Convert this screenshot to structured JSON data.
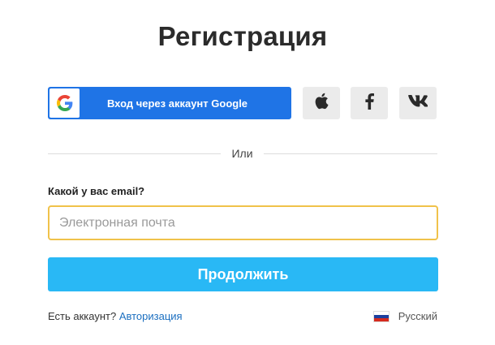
{
  "page": {
    "title": "Регистрация"
  },
  "social": {
    "google_label": "Вход через аккаунт Google",
    "icons": [
      "google-icon",
      "apple-icon",
      "facebook-icon",
      "vk-icon"
    ]
  },
  "divider": {
    "text": "Или"
  },
  "form": {
    "email_label": "Какой у вас email?",
    "email_placeholder": "Электронная почта",
    "email_value": "",
    "continue_label": "Продолжить"
  },
  "footer": {
    "account_text": "Есть аккаунт?",
    "login_link": "Авторизация",
    "language": "Русский"
  },
  "colors": {
    "google_blue": "#1f74e6",
    "primary_button": "#29b8f5",
    "input_focus_border": "#f0c24a",
    "link": "#1b6fc0",
    "social_bg": "#ebebeb"
  }
}
